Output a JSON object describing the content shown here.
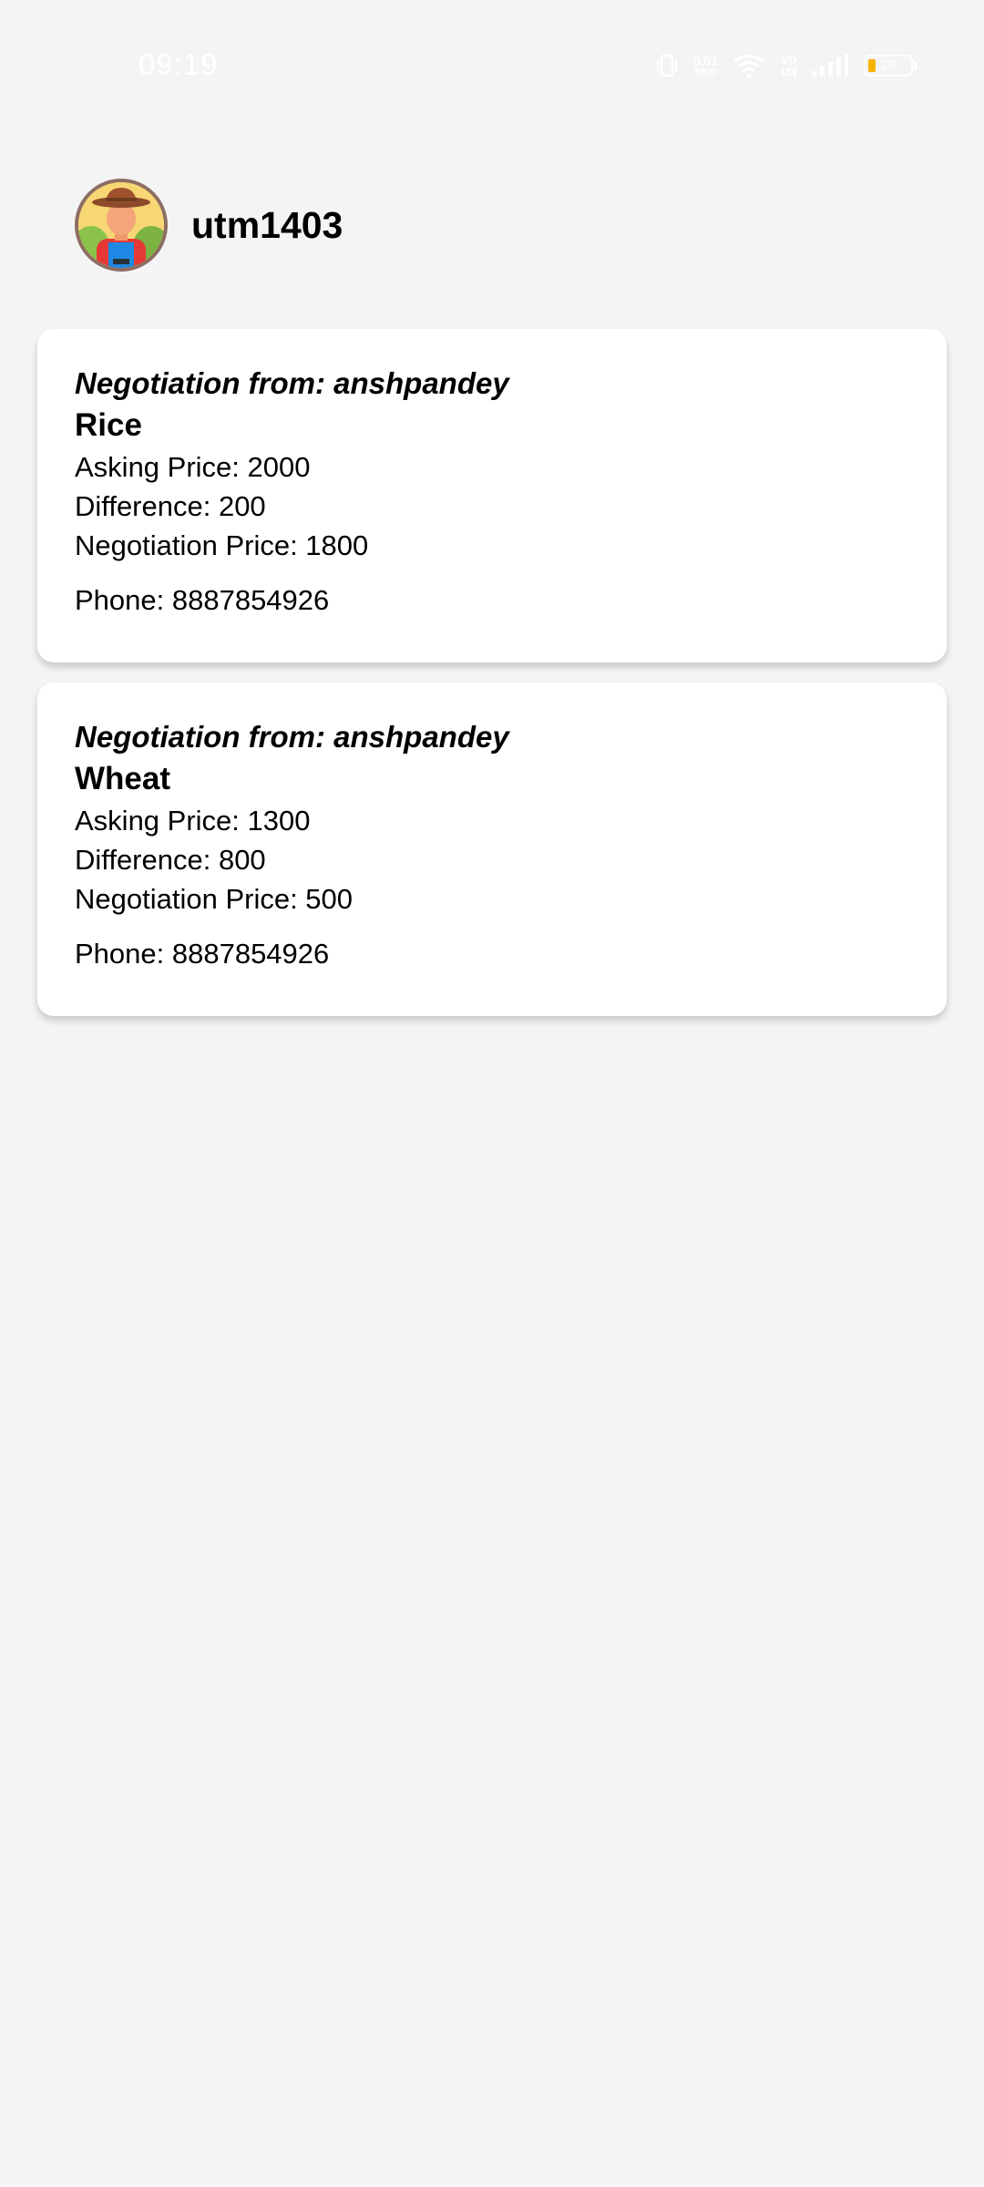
{
  "status_bar": {
    "time": "09:19",
    "speed_value": "0.01",
    "speed_unit": "KB/S",
    "battery_level": "20",
    "icons": [
      "vibrate-icon",
      "wifi-icon",
      "volte-icon",
      "signal-icon",
      "battery-icon"
    ]
  },
  "profile": {
    "username": "utm1403",
    "avatar_icon": "farmer-avatar"
  },
  "negotiations": [
    {
      "from": "Negotiation from: anshpandey",
      "crop": "Rice",
      "asking_price": "Asking Price: 2000",
      "difference": "Difference: 200",
      "negotiation_price": "Negotiation Price: 1800",
      "phone": "Phone: 8887854926"
    },
    {
      "from": "Negotiation from: anshpandey",
      "crop": "Wheat",
      "asking_price": "Asking Price: 1300",
      "difference": "Difference: 800",
      "negotiation_price": "Negotiation Price: 500",
      "phone": "Phone: 8887854926"
    }
  ],
  "colors": {
    "background": "#f4f4f4",
    "card": "#ffffff",
    "battery_accent": "#f5b400"
  }
}
